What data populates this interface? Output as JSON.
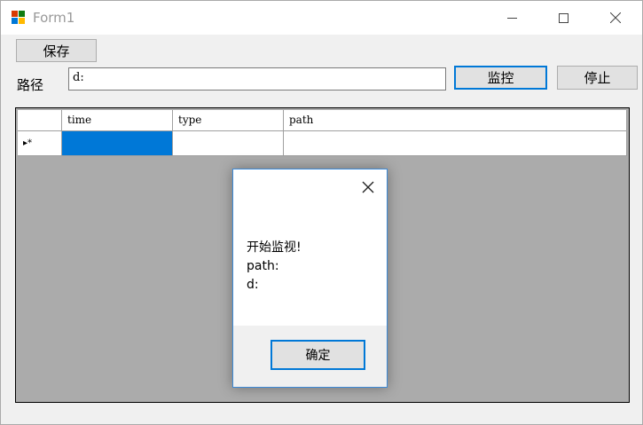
{
  "window": {
    "title": "Form1",
    "icon": "winforms-app-icon",
    "controls": [
      "minimize-icon",
      "maximize-icon",
      "close-icon"
    ]
  },
  "toolbar": {
    "save_label": "保存",
    "path_label": "路径",
    "path_value": "d:",
    "monitor_label": "监控",
    "stop_label": "停止"
  },
  "grid": {
    "columns": [
      "time",
      "type",
      "path"
    ],
    "new_row_indicator": "▸*",
    "rows": [
      {
        "time": "",
        "type": "",
        "path": ""
      }
    ]
  },
  "dialog": {
    "message": "开始监视!\npath:\nd:",
    "ok_label": "确定",
    "close_icon": "close-icon"
  },
  "colors": {
    "accent": "#0078d7",
    "grid_background": "#ababab",
    "button_face": "#e1e1e1"
  }
}
